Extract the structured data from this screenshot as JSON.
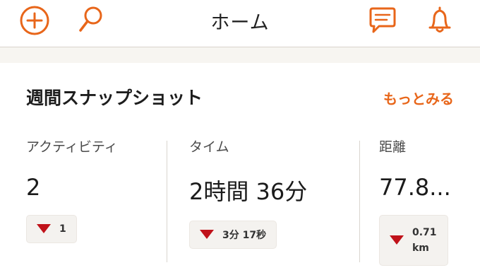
{
  "header": {
    "title": "ホーム",
    "icons": [
      "plus-circle-icon",
      "search-icon",
      "chat-icon",
      "bell-icon"
    ],
    "accent_color": "#e8661a"
  },
  "weekly": {
    "title": "週間スナップショット",
    "more_label": "もっとみる",
    "stats": [
      {
        "label": "アクティビティ",
        "value": "2",
        "change": "1"
      },
      {
        "label": "タイム",
        "value": "2時間 36分",
        "change": "3分 17秒"
      },
      {
        "label": "距離",
        "value": "77.8...",
        "change_line1": "0.71",
        "change_line2": "km"
      }
    ],
    "down_color": "#c0121a"
  }
}
